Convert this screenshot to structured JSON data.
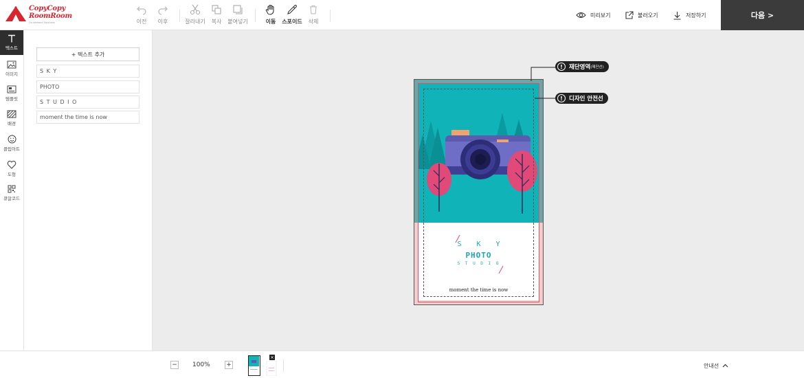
{
  "logo": {
    "line1": "CopyCopy",
    "line2": "RoomRoom",
    "tagline": "On-demand Solutions"
  },
  "toolbar": {
    "undo": "이전",
    "redo": "이후",
    "cut": "잘라내기",
    "copy": "복사",
    "paste": "붙여넣기",
    "move": "이동",
    "eyedropper": "스포이드",
    "delete": "삭제",
    "preview": "미리보기",
    "load": "불러오기",
    "save": "저장하기",
    "next": "다음 >"
  },
  "sidebar": {
    "items": [
      {
        "label": "텍스트",
        "icon": "text-icon"
      },
      {
        "label": "이미지",
        "icon": "image-icon"
      },
      {
        "label": "템플릿",
        "icon": "template-icon"
      },
      {
        "label": "배경",
        "icon": "background-icon"
      },
      {
        "label": "클립아트",
        "icon": "clipart-icon"
      },
      {
        "label": "도형",
        "icon": "shape-icon"
      },
      {
        "label": "큐알코드",
        "icon": "qr-code-icon"
      }
    ]
  },
  "text_panel": {
    "add_label": "+ 텍스트 추가",
    "items": [
      "S K Y",
      "PHOTO",
      "S T U D I O",
      "moment the time is now"
    ]
  },
  "design": {
    "sky": "S K Y",
    "photo": "PHOTO",
    "studio": "S T U D I O",
    "moment": "moment the time is now"
  },
  "callouts": {
    "bleed": "재단영역",
    "bleed_small": "(재단선)",
    "safe": "디자인 안전선"
  },
  "bottom": {
    "zoom": "100%",
    "zoom_out": "−",
    "zoom_in": "+",
    "guide": "안내선"
  },
  "colors": {
    "accent_dark": "#3b3b3b",
    "teal": "#0fb3b8",
    "brand_red": "#d7262f"
  }
}
